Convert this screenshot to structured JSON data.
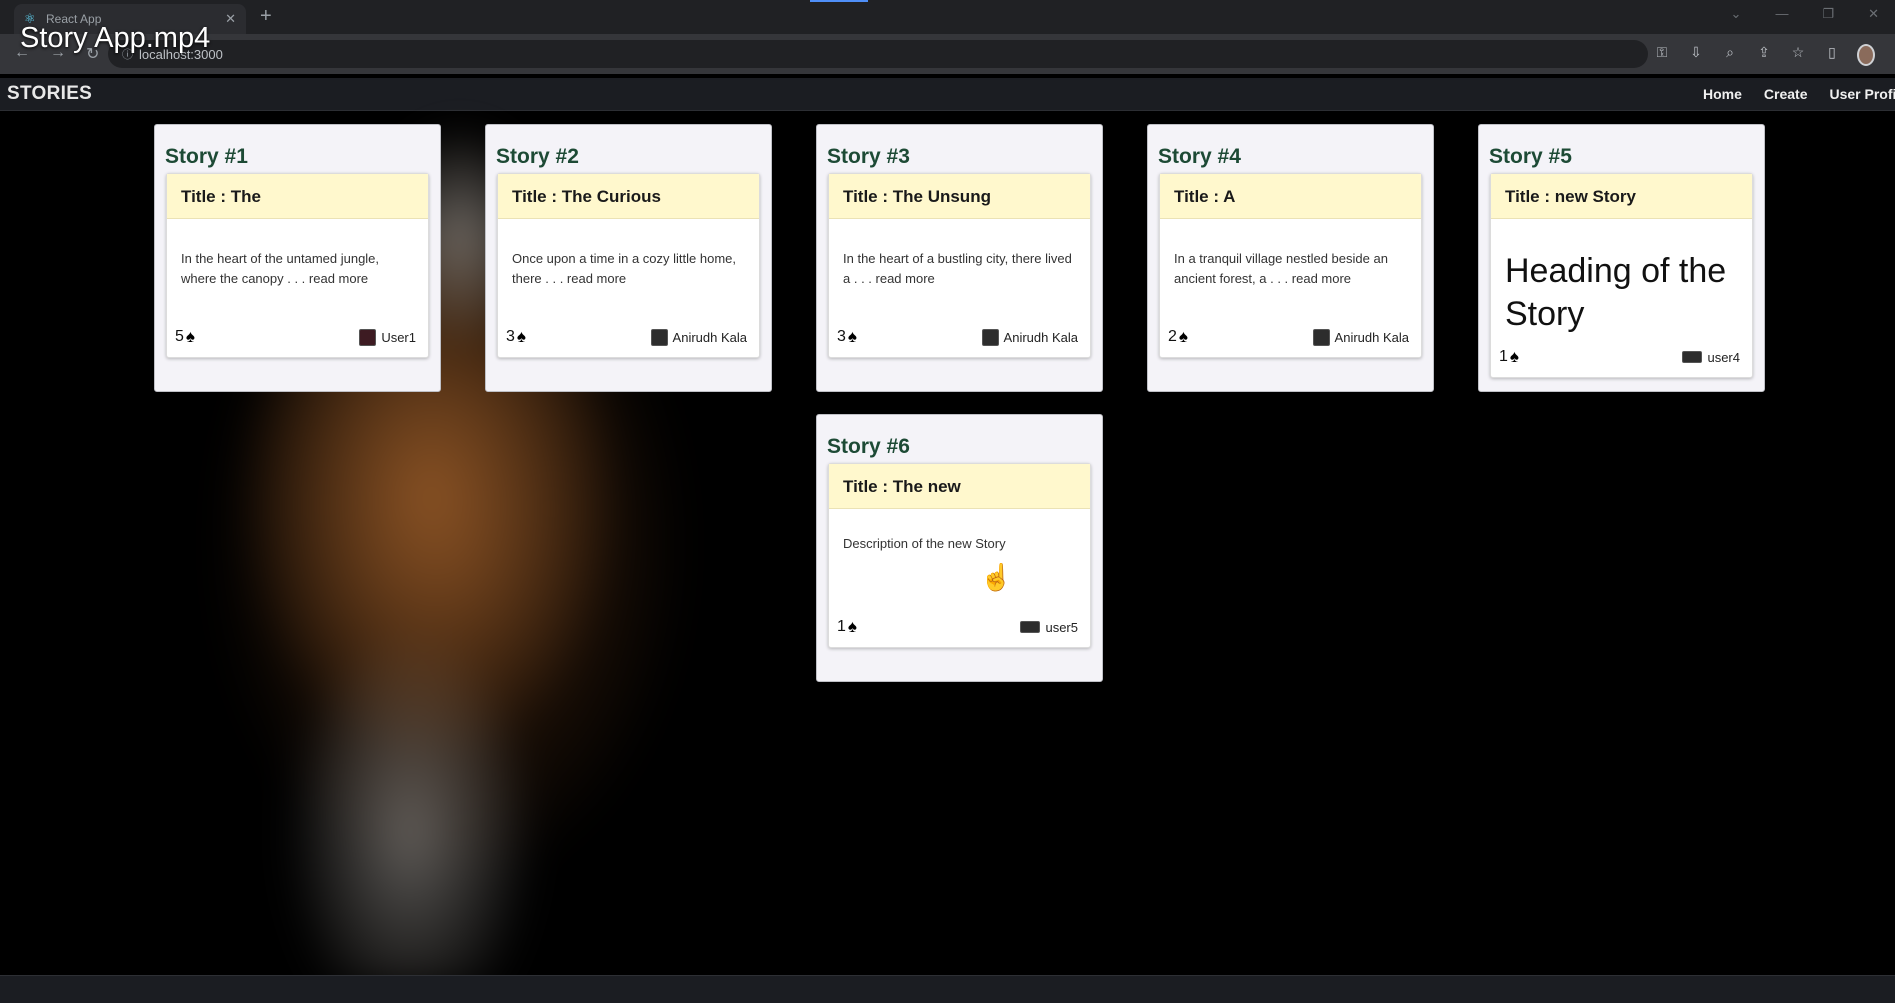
{
  "video": {
    "title": "Story App.mp4"
  },
  "browser": {
    "tab_title": "React App",
    "url": "localhost:3000"
  },
  "app": {
    "brand": "STORIES",
    "nav": {
      "home": "Home",
      "create": "Create",
      "profile": "User Profi"
    }
  },
  "stories": [
    {
      "heading": "Story #1",
      "title": "Title : The",
      "description": "In the heart of the untamed jungle, where the canopy . . . read more",
      "votes": "5",
      "author": "User1"
    },
    {
      "heading": "Story #2",
      "title": "Title : The Curious",
      "description": "Once upon a time in a cozy little home, there . . . read more",
      "votes": "3",
      "author": "Anirudh Kala"
    },
    {
      "heading": "Story #3",
      "title": "Title : The Unsung",
      "description": "In the heart of a bustling city, there lived a . . . read more",
      "votes": "3",
      "author": "Anirudh Kala"
    },
    {
      "heading": "Story #4",
      "title": "Title : A",
      "description": "In a tranquil village nestled beside an ancient forest, a . . . read more",
      "votes": "2",
      "author": "Anirudh Kala"
    },
    {
      "heading": "Story #5",
      "title": "Title : new Story",
      "big_heading": "Heading of the Story",
      "votes": "1",
      "author": "user4"
    },
    {
      "heading": "Story #6",
      "title": "Title : The new",
      "description": "Description of the new Story",
      "votes": "1",
      "author": "user5"
    }
  ],
  "colors": {
    "story_heading": "#1d4a35",
    "title_bar": "#fff8cd",
    "navbar": "#1b1d22"
  }
}
